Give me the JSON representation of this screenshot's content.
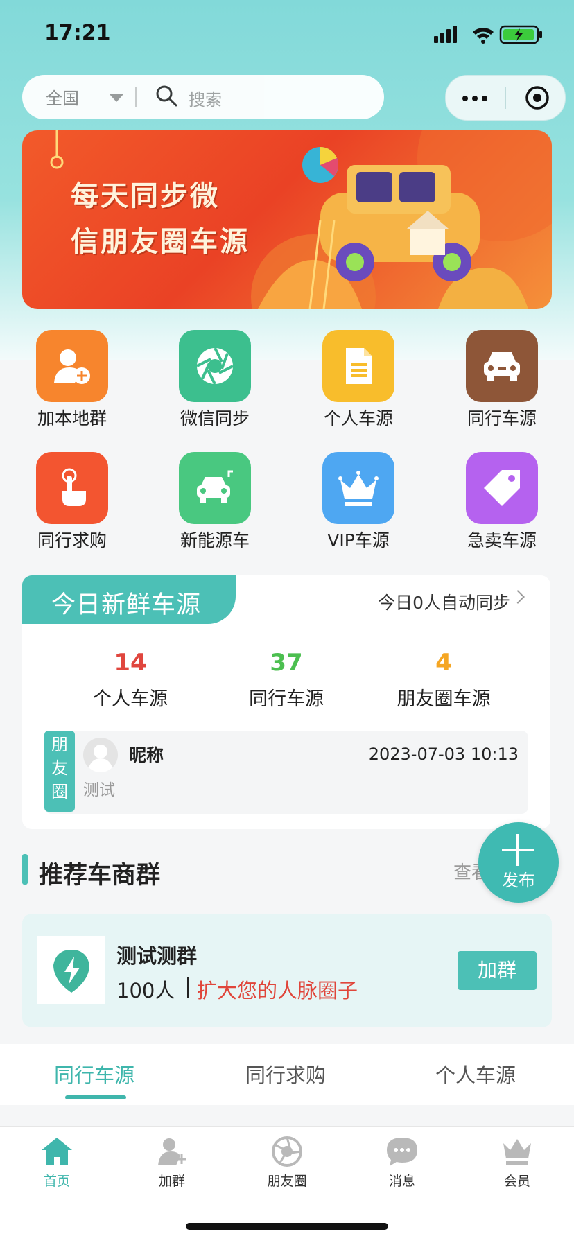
{
  "status": {
    "time": "17:21"
  },
  "search": {
    "region": "全国",
    "placeholder": "搜索"
  },
  "banner": {
    "line1": "每天同步微",
    "line2": "信朋友圈车源"
  },
  "grid": [
    {
      "label": "加本地群",
      "icon": "add-user-icon",
      "color": "#f7852d"
    },
    {
      "label": "微信同步",
      "icon": "aperture-icon",
      "color": "#3cbf8e"
    },
    {
      "label": "个人车源",
      "icon": "document-icon",
      "color": "#f8bd2c"
    },
    {
      "label": "同行车源",
      "icon": "car-icon",
      "color": "#8e5638"
    },
    {
      "label": "同行求购",
      "icon": "tap-hand-icon",
      "color": "#f35530"
    },
    {
      "label": "新能源车",
      "icon": "electric-car-icon",
      "color": "#49c880"
    },
    {
      "label": "VIP车源",
      "icon": "crown-icon",
      "color": "#4ea7f2"
    },
    {
      "label": "急卖车源",
      "icon": "price-tag-icon",
      "color": "#b562ef"
    }
  ],
  "fresh": {
    "tag": "今日新鲜车源",
    "sync": "今日0人自动同步",
    "stats": [
      {
        "value": "14",
        "label": "个人车源",
        "color": "#e0463e"
      },
      {
        "value": "37",
        "label": "同行车源",
        "color": "#4cbf50"
      },
      {
        "value": "4",
        "label": "朋友圈车源",
        "color": "#f5a623"
      }
    ],
    "post": {
      "side_label": "朋\n友\n圈",
      "nickname": "昵称",
      "content": "测试",
      "time": "2023-07-03 10:13"
    }
  },
  "recommend": {
    "title": "推荐车商群",
    "more": "查看",
    "fab_label": "发布",
    "group": {
      "name": "测试测群",
      "count": "100人",
      "slogan": "扩大您的人脉圈子",
      "join": "加群"
    }
  },
  "tabs": [
    {
      "label": "同行车源",
      "active": true
    },
    {
      "label": "同行求购",
      "active": false
    },
    {
      "label": "个人车源",
      "active": false
    }
  ],
  "nav": [
    {
      "label": "首页",
      "icon": "home-icon",
      "active": true
    },
    {
      "label": "加群",
      "icon": "add-group-icon",
      "active": false
    },
    {
      "label": "朋友圈",
      "icon": "moments-icon",
      "active": false
    },
    {
      "label": "消息",
      "icon": "message-icon",
      "active": false
    },
    {
      "label": "会员",
      "icon": "crown-icon",
      "active": false
    }
  ],
  "colors": {
    "accent": "#3fb6ac",
    "header": "#82d9d9"
  }
}
